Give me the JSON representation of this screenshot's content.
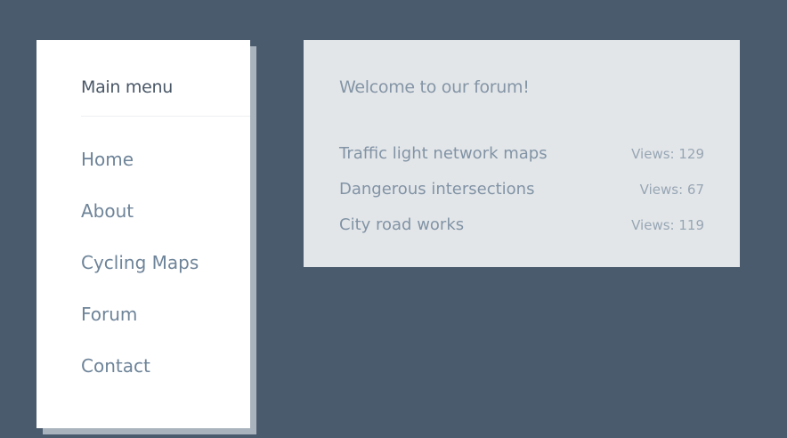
{
  "menu": {
    "title": "Main menu",
    "items": [
      {
        "label": "Home"
      },
      {
        "label": "About"
      },
      {
        "label": "Cycling Maps"
      },
      {
        "label": "Forum"
      },
      {
        "label": "Contact"
      }
    ]
  },
  "forum": {
    "title": "Welcome to our forum!",
    "topics": [
      {
        "title": "Traffic light network maps",
        "views": "Views: 129"
      },
      {
        "title": "Dangerous intersections",
        "views": "Views: 67"
      },
      {
        "title": "City road works",
        "views": "Views: 119"
      }
    ]
  },
  "colors": {
    "background": "#4a5b6e",
    "menu_card": "#ffffff",
    "forum_panel": "#e3e6e9",
    "menu_text": "#6e8499"
  }
}
